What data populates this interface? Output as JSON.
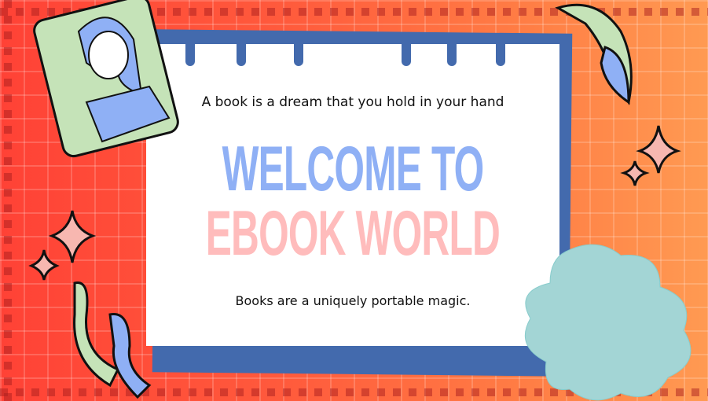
{
  "slide": {
    "quote_top": "A book is a dream that you hold in your hand",
    "title_line1": "WELCOME TO",
    "title_line2": "EBOOK WORLD",
    "quote_bottom": "Books are a uniquely portable magic."
  },
  "colors": {
    "title_line1": "#8fb0f5",
    "title_line2": "#ffbcbc",
    "paper_back": "#436aad",
    "flower": "#a3d5d5",
    "ribbon": "#c5e3b8"
  }
}
